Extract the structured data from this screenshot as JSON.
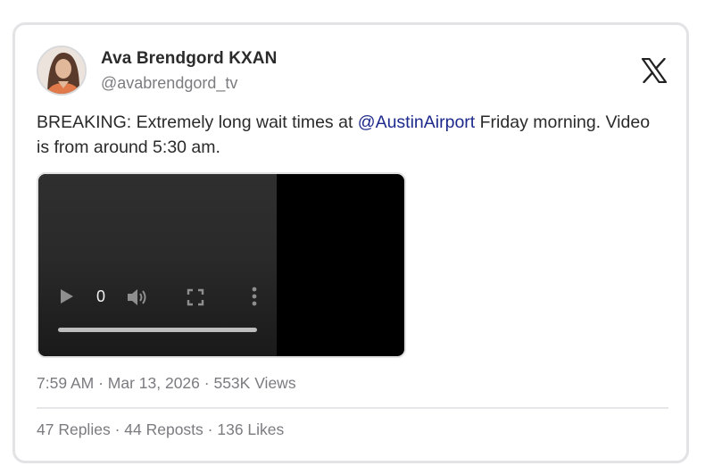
{
  "author": {
    "name": "Ava Brendgord KXAN",
    "handle": "@avabrendgord_tv"
  },
  "tweet": {
    "text_before": "BREAKING: Extremely long wait times at ",
    "mention": "@AustinAirport",
    "text_after": " Friday morning. Video is from around 5:30 am."
  },
  "video": {
    "current_time": "0",
    "progress": 0
  },
  "meta": {
    "time": "7:59 AM",
    "date": "Mar 13, 2026",
    "views": "553K Views",
    "separator": " · "
  },
  "stats": {
    "replies": "47 Replies",
    "reposts": "44 Reposts",
    "likes": "136 Likes"
  },
  "icons": {
    "platform_logo": "x-logo-icon",
    "play": "play-icon",
    "volume": "volume-icon",
    "fullscreen": "fullscreen-icon",
    "more": "more-options-icon"
  },
  "colors": {
    "mention": "#1d2a8c",
    "secondary_text": "#7b7b80",
    "card_border": "#e3e3e5"
  }
}
